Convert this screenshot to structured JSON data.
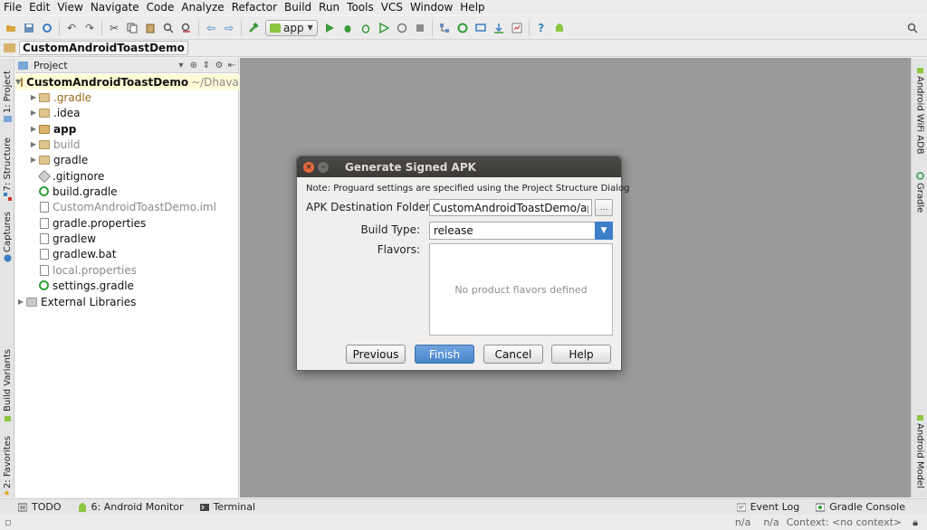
{
  "menu": [
    "File",
    "Edit",
    "View",
    "Navigate",
    "Code",
    "Analyze",
    "Refactor",
    "Build",
    "Run",
    "Tools",
    "VCS",
    "Window",
    "Help"
  ],
  "toolbar": {
    "run_config": "app",
    "icons": [
      "open-icon",
      "save-all-icon",
      "sync-icon",
      "undo-icon",
      "redo-icon",
      "cut-icon",
      "copy-icon",
      "paste-icon",
      "find-icon",
      "replace-icon",
      "back-icon",
      "forward-icon",
      "make-project-icon",
      "run-icon",
      "debug-icon",
      "attach-debugger-icon",
      "coverage-icon",
      "profile-icon",
      "stop-icon",
      "project-structure-icon",
      "gradle-sync-icon",
      "avd-manager-icon",
      "sdk-manager-icon",
      "monitor-icon",
      "help-icon",
      "android-icon",
      "search-everywhere-icon"
    ]
  },
  "breadcrumb": {
    "project": "CustomAndroidToastDemo"
  },
  "left_stripe": {
    "tabs": [
      "1: Project",
      "7: Structure",
      "Captures",
      "Build Variants",
      "2: Favorites"
    ]
  },
  "right_stripe": {
    "tabs": [
      "Android WiFi ADB",
      "Gradle",
      "Android Model"
    ]
  },
  "project_panel": {
    "title": "Project",
    "root": {
      "label": "CustomAndroidToastDemo",
      "path": "~/Dhaval/A"
    },
    "items": [
      {
        "label": ".gradle",
        "icon": "folder-icon",
        "style": "orange"
      },
      {
        "label": ".idea",
        "icon": "folder-icon",
        "style": "normal"
      },
      {
        "label": "app",
        "icon": "module-folder-icon",
        "style": "bold"
      },
      {
        "label": "build",
        "icon": "folder-icon",
        "style": "gray"
      },
      {
        "label": "gradle",
        "icon": "folder-icon",
        "style": "normal"
      },
      {
        "label": ".gitignore",
        "icon": "git-file-icon",
        "style": "normal"
      },
      {
        "label": "build.gradle",
        "icon": "gradle-file-icon",
        "style": "normal"
      },
      {
        "label": "CustomAndroidToastDemo.iml",
        "icon": "file-icon",
        "style": "gray"
      },
      {
        "label": "gradle.properties",
        "icon": "file-icon",
        "style": "normal"
      },
      {
        "label": "gradlew",
        "icon": "file-icon",
        "style": "normal"
      },
      {
        "label": "gradlew.bat",
        "icon": "file-icon",
        "style": "normal"
      },
      {
        "label": "local.properties",
        "icon": "file-icon",
        "style": "gray"
      },
      {
        "label": "settings.gradle",
        "icon": "gradle-file-icon",
        "style": "normal"
      }
    ],
    "external": "External Libraries"
  },
  "dialog": {
    "title": "Generate Signed APK",
    "note": "Note: Proguard settings are specified using the Project Structure Dialog",
    "apk_label": "APK Destination Folder:",
    "apk_value": "CustomAndroidToastDemo/app",
    "browse_label": "...",
    "build_type_label": "Build Type:",
    "build_type_value": "release",
    "flavors_label": "Flavors:",
    "flavors_empty": "No product flavors defined",
    "buttons": {
      "previous": "Previous",
      "finish": "Finish",
      "cancel": "Cancel",
      "help": "Help"
    }
  },
  "bottom_bar": {
    "todo": "TODO",
    "monitor": "6: Android Monitor",
    "terminal": "Terminal",
    "event_log": "Event Log",
    "gradle_console": "Gradle Console"
  },
  "status_bar": {
    "pos1": "n/a",
    "pos2": "n/a",
    "context": "Context: <no context>"
  },
  "colors": {
    "accent_blue": "#4a85cc",
    "gradle_green": "#2e9e3b",
    "editor_bg": "#9a9a9a",
    "selected_row": "#fffbd7"
  }
}
